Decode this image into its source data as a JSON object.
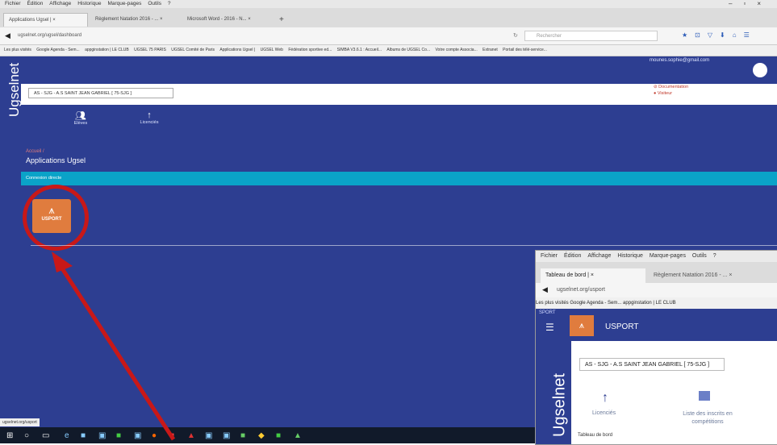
{
  "browser": {
    "menu": [
      "Fichier",
      "Édition",
      "Affichage",
      "Historique",
      "Marque-pages",
      "Outils",
      "?"
    ],
    "tabs": [
      "Applications Ugsel |",
      "Règlement Natation 2016 - ...",
      "Microsoft Word - 2016 - N..."
    ],
    "url": "ugselnet.org/ugsel/dashboard",
    "search_placeholder": "Rechercher",
    "bookmarks": [
      "Les plus visités",
      "Google Agenda - Sem...",
      "appginstation | LE CLUB",
      "UGSEL 75 PARIS",
      "UGSEL Comité de Paris",
      "Applications Ugsel |",
      "UGSEL Web",
      "Fédération sportive ed...",
      "SIMBA V3.6.1 : Accueil...",
      "Albums de UGSEL Co...",
      "Votre compte Associa...",
      "Extranet",
      "Portail des télé-service..."
    ],
    "status_url": "ugselnet.org/usport"
  },
  "app": {
    "brand": "Ugselnet",
    "user_email": "mounes.sophie@gmail.com",
    "school": "AS - SJG - A.S SAINT JEAN GABRIEL [ 75-SJG ]",
    "links": [
      "Documentation",
      "Visiteur"
    ],
    "nav": [
      {
        "label": "Elèves"
      },
      {
        "label": "Licenciés"
      }
    ],
    "breadcrumb": "Accueil /",
    "page_title": "Applications Ugsel",
    "section_header": "Connexion directe",
    "app_tile": {
      "name": "USPORT"
    }
  },
  "inset": {
    "menu": [
      "Fichier",
      "Édition",
      "Affichage",
      "Historique",
      "Marque-pages",
      "Outils",
      "?"
    ],
    "tabs": [
      "Tableau de bord |",
      "Règlement Natation 2016 - ..."
    ],
    "url": "ugselnet.org/usport",
    "bookmarks": "Les plus visités   Google Agenda - Sem...   appginstation | LE CLUB",
    "sport_label": "SPORT",
    "app_name": "USPORT",
    "school": "AS - SJG - A.S SAINT JEAN GABRIEL [ 75-SJG ]",
    "brand": "Ugselnet",
    "licencies": "Licenciés",
    "liste": "Liste des inscrits en compétitions",
    "bottom": "Tableau de bord"
  }
}
